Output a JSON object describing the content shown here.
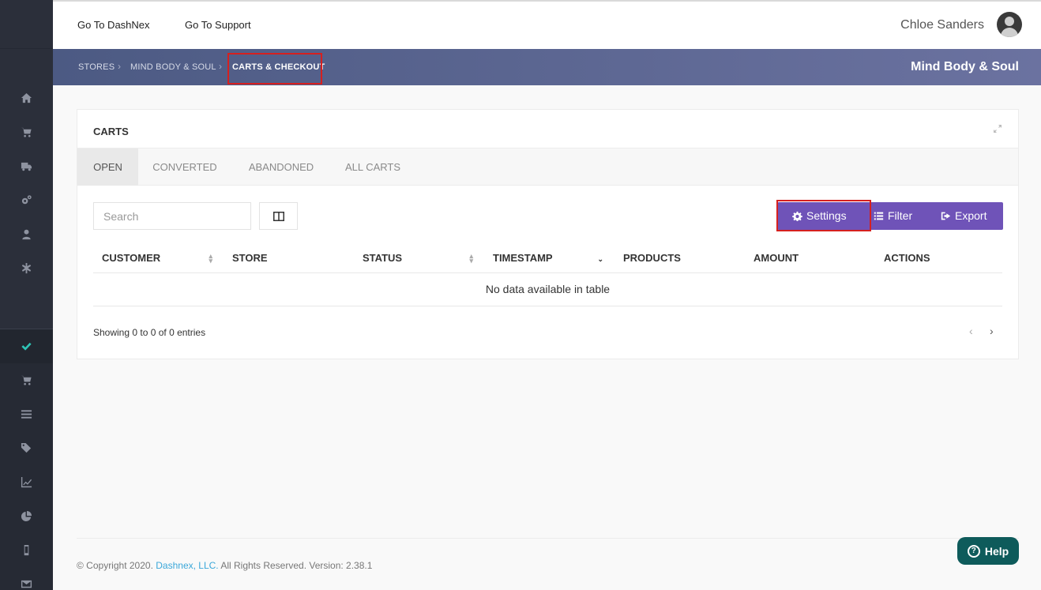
{
  "header": {
    "link_dashnex": "Go To DashNex",
    "link_support": "Go To Support",
    "user_name": "Chloe Sanders"
  },
  "breadcrumb": {
    "items": [
      "STORES",
      "MIND BODY & SOUL",
      "CARTS & CHECKOUT"
    ],
    "store_title": "Mind Body & Soul"
  },
  "card": {
    "title": "CARTS",
    "tabs": [
      "OPEN",
      "CONVERTED",
      "ABANDONED",
      "ALL CARTS"
    ],
    "active_tab": "OPEN"
  },
  "toolbar": {
    "search_placeholder": "Search",
    "settings_label": "Settings",
    "filter_label": "Filter",
    "export_label": "Export"
  },
  "table": {
    "columns": [
      "CUSTOMER",
      "STORE",
      "STATUS",
      "TIMESTAMP",
      "PRODUCTS",
      "AMOUNT",
      "ACTIONS"
    ],
    "empty_text": "No data available in table",
    "showing_text": "Showing 0 to 0 of 0 entries"
  },
  "footer": {
    "prefix": "© Copyright 2020.",
    "company": "Dashnex, LLC.",
    "suffix": "All Rights Reserved. Version: 2.38.1"
  },
  "help": {
    "label": "Help"
  },
  "sidebar": {
    "icons": [
      "home-icon",
      "cart-icon",
      "truck-icon",
      "cogs-icon",
      "user-icon",
      "asterisk-icon",
      "check-icon",
      "cart-icon",
      "list-icon",
      "tags-icon",
      "line-chart-icon",
      "pie-chart-icon",
      "mobile-icon",
      "envelope-icon"
    ]
  },
  "colors": {
    "accent_purple": "#6f53b8",
    "highlight_red": "#d6201f",
    "sidebar_bg": "#2b2f3a",
    "active_check": "#2ec4b6",
    "help_bg": "#0e5b5b"
  }
}
